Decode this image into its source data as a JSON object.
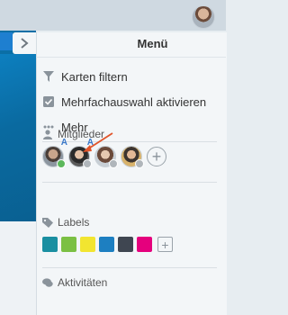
{
  "menu": {
    "title": "Menü",
    "items": [
      {
        "label": "Karten filtern",
        "icon": "filter-icon"
      },
      {
        "label": "Mehrfachauswahl aktivieren",
        "icon": "checkbox-icon"
      },
      {
        "label": "Mehr",
        "icon": "more-dots-icon"
      }
    ]
  },
  "members": {
    "title": "Mitglieder",
    "admin_marker": "A",
    "avatars": [
      {
        "status": "online",
        "status_color": "#5cb85c",
        "admin": true
      },
      {
        "status": "offline",
        "status_color": "#b0b6bb",
        "admin": true
      },
      {
        "status": "offline",
        "status_color": "#b0b6bb",
        "admin": false
      },
      {
        "status": "offline",
        "status_color": "#b0b6bb",
        "admin": false
      }
    ],
    "add_label": "+"
  },
  "labels": {
    "title": "Labels",
    "colors": [
      "#1a8fa1",
      "#7bc043",
      "#f2e530",
      "#1d7fc1",
      "#3f4651",
      "#e5007d"
    ],
    "add_label": "+"
  },
  "activities": {
    "title": "Aktivitäten"
  },
  "colors": {
    "annotation_arrow": "#e1552b",
    "admin_badge": "#3a78c9"
  }
}
